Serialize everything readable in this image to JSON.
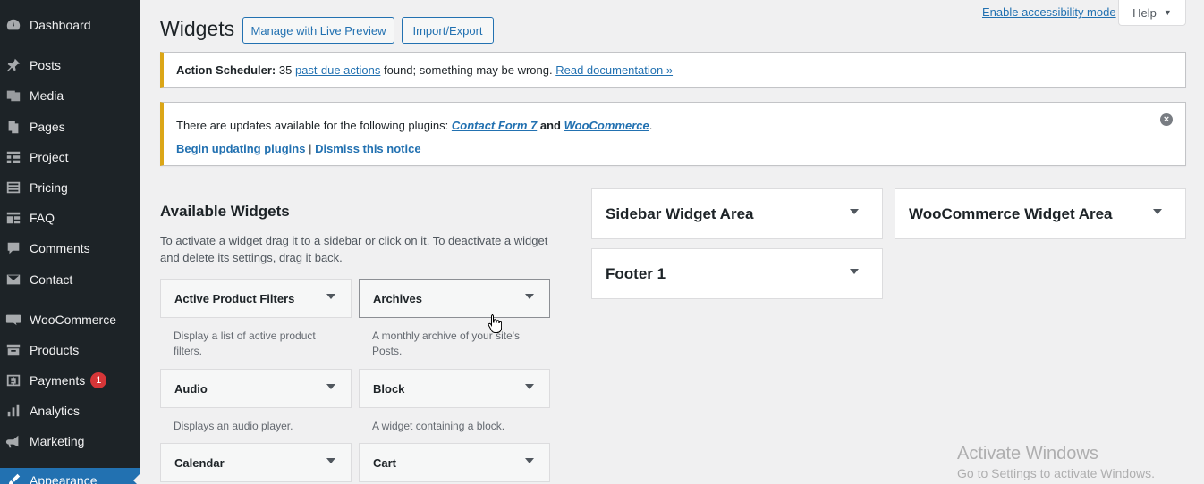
{
  "sidebar": {
    "items": [
      {
        "label": "Dashboard",
        "icon": "dashboard-icon"
      },
      {
        "label": "Posts",
        "icon": "pin-icon"
      },
      {
        "label": "Media",
        "icon": "media-icon"
      },
      {
        "label": "Pages",
        "icon": "pages-icon"
      },
      {
        "label": "Project",
        "icon": "project-icon"
      },
      {
        "label": "Pricing",
        "icon": "pricing-icon"
      },
      {
        "label": "FAQ",
        "icon": "faq-icon"
      },
      {
        "label": "Comments",
        "icon": "comments-icon"
      },
      {
        "label": "Contact",
        "icon": "mail-icon"
      },
      {
        "label": "WooCommerce",
        "icon": "woocommerce-icon"
      },
      {
        "label": "Products",
        "icon": "archive-box-icon"
      },
      {
        "label": "Payments",
        "icon": "dollar-icon",
        "badge": "1"
      },
      {
        "label": "Analytics",
        "icon": "bar-chart-icon"
      },
      {
        "label": "Marketing",
        "icon": "megaphone-icon"
      },
      {
        "label": "Appearance",
        "icon": "paintbrush-icon"
      }
    ]
  },
  "header": {
    "title": "Widgets",
    "manage_live_preview": "Manage with Live Preview",
    "import_export": "Import/Export",
    "accessibility_link": "Enable accessibility mode",
    "help": "Help"
  },
  "notice_scheduler": {
    "bold": "Action Scheduler:",
    "count": "35",
    "link1": "past-due actions",
    "middle": "found; something may be wrong.",
    "link2": "Read documentation »"
  },
  "notice_updates": {
    "text_before": "There are updates available for the following plugins:",
    "plugin1": "Contact Form 7",
    "and": "and",
    "plugin2": "WooCommerce",
    "period": ".",
    "begin_link": "Begin updating plugins",
    "separator": "|",
    "dismiss_link": "Dismiss this notice"
  },
  "available": {
    "title": "Available Widgets",
    "description": "To activate a widget drag it to a sidebar or click on it. To deactivate a widget and delete its settings, drag it back.",
    "widgets": [
      {
        "name": "Active Product Filters",
        "desc": "Display a list of active product filters."
      },
      {
        "name": "Archives",
        "desc": "A monthly archive of your site's Posts."
      },
      {
        "name": "Audio",
        "desc": "Displays an audio player."
      },
      {
        "name": "Block",
        "desc": "A widget containing a block."
      },
      {
        "name": "Calendar",
        "desc": ""
      },
      {
        "name": "Cart",
        "desc": ""
      }
    ]
  },
  "areas": [
    {
      "name": "Sidebar Widget Area"
    },
    {
      "name": "WooCommerce Widget Area"
    },
    {
      "name": "Footer 1"
    }
  ],
  "watermark": {
    "title": "Activate Windows",
    "subtitle": "Go to Settings to activate Windows."
  },
  "colors": {
    "sidebar_bg": "#1d2327",
    "accent": "#2271b1",
    "notice_warning": "#dba617",
    "badge": "#d63638"
  }
}
